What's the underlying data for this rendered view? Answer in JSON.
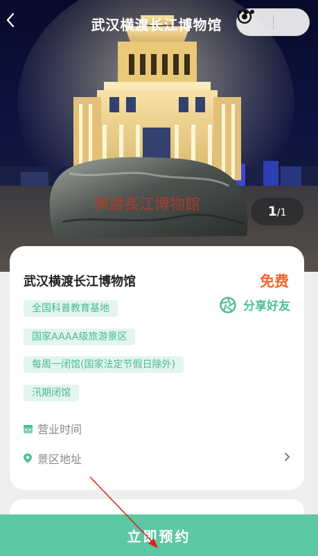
{
  "header": {
    "title": "武汉横渡长江博物馆",
    "back_icon": "chevron-left-icon",
    "more_icon": "more-dots-icon",
    "close_icon": "record-target-icon"
  },
  "gallery": {
    "current": "1",
    "separator": "/",
    "total": "1",
    "stone_inscription": "横渡長江博物館"
  },
  "venue": {
    "name": "武汉横渡长江博物馆",
    "price": "免费",
    "share_label": "分享好友",
    "share_icon": "share-aperture-icon",
    "accent_color": "#5ec7a3",
    "price_color": "#f1652e",
    "tags": [
      "全国科普教育基地",
      "国家AAAA级旅游景区",
      "每周一闭馆(国家法定节假日除外)",
      "汛期闭馆"
    ],
    "hours_label": "营业时间",
    "address_label": "景区地址"
  },
  "footer": {
    "book_label": "立即预约"
  }
}
